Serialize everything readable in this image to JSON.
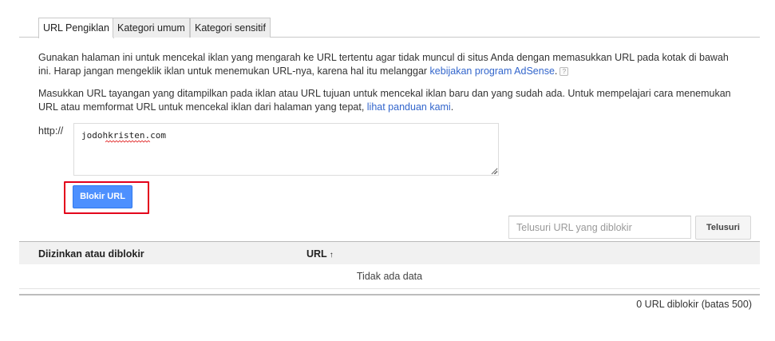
{
  "tabs": [
    {
      "label": "URL Pengiklan",
      "active": true
    },
    {
      "label": "Kategori umum",
      "active": false
    },
    {
      "label": "Kategori sensitif",
      "active": false
    }
  ],
  "intro": {
    "text": "Gunakan halaman ini untuk mencekal iklan yang mengarah ke URL tertentu agar tidak muncul di situs Anda dengan memasukkan URL pada kotak di bawah ini. Harap jangan mengeklik iklan untuk menemukan URL-nya, karena hal itu melanggar ",
    "link": "kebijakan program AdSense",
    "trail": ".",
    "help_icon_text": "?"
  },
  "instructions": {
    "text": "Masukkan URL tayangan yang ditampilkan pada iklan atau URL tujuan untuk mencekal iklan baru dan yang sudah ada. Untuk mempelajari cara menemukan URL atau memformat URL untuk mencekal iklan dari halaman yang tepat, ",
    "link": "lihat panduan kami",
    "trail": "."
  },
  "url_form": {
    "prefix": "http://",
    "value": "jodohkristen.com",
    "submit_label": "Blokir URL"
  },
  "search": {
    "placeholder": "Telusuri URL yang diblokir",
    "value": "",
    "button_label": "Telusuri"
  },
  "table": {
    "columns": [
      "Diizinkan atau diblokir",
      "URL"
    ],
    "sort_indicator": "↑",
    "empty_text": "Tidak ada data"
  },
  "footer": {
    "count_text": "0 URL diblokir (batas 500)"
  },
  "colors": {
    "link": "#3366cc",
    "primary_button": "#4d90fe",
    "highlight": "#e3001b"
  }
}
